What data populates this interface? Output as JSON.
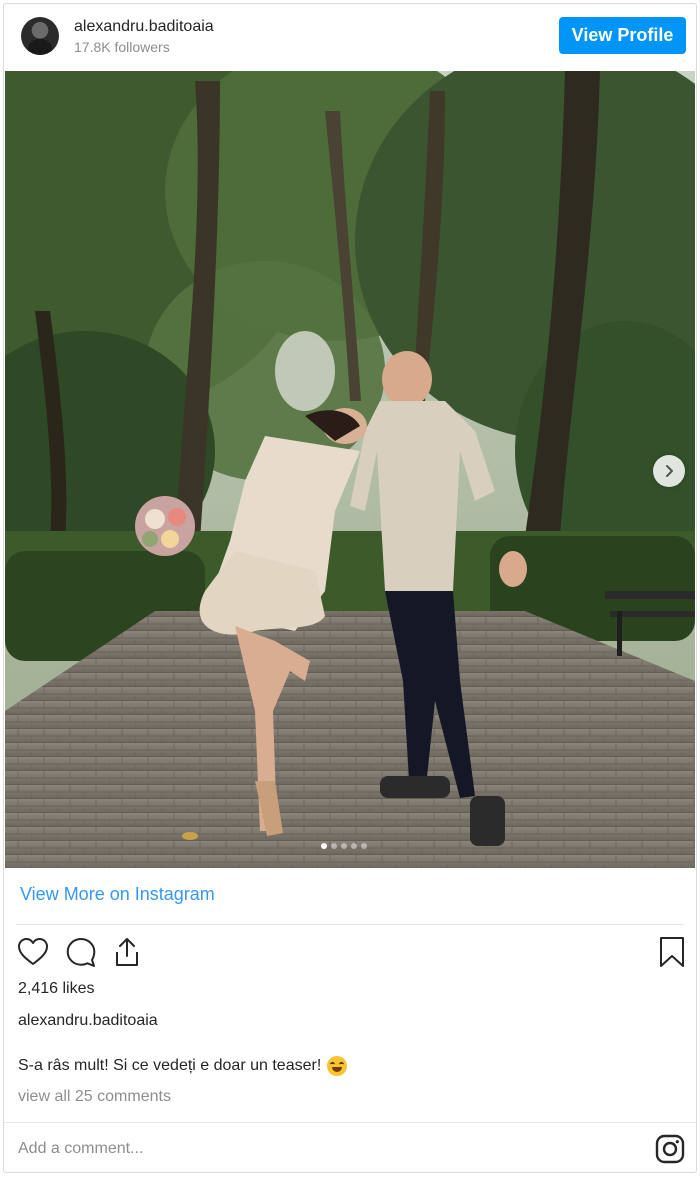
{
  "header": {
    "username": "alexandru.baditoaia",
    "followers": "17.8K followers",
    "view_profile_label": "View Profile"
  },
  "post": {
    "carousel": {
      "total_slides": 5,
      "active_slide": 1
    },
    "view_more_label": "View More on Instagram",
    "likes": "2,416 likes",
    "caption_username": "alexandru.baditoaia",
    "caption_text": "S-a râs mult! Si ce vedeți e doar un teaser!",
    "view_comments_label": "view all 25 comments",
    "add_comment_placeholder": "Add a comment..."
  },
  "icons": {
    "like": "heart-icon",
    "comment": "comment-icon",
    "share": "share-icon",
    "save": "bookmark-icon",
    "next": "chevron-right-icon",
    "instagram": "instagram-logo-icon",
    "emoji": "grinning-sweat-emoji"
  },
  "colors": {
    "accent": "#0095f6",
    "link": "#3897f0",
    "muted": "#8e8e8e",
    "text": "#262626"
  }
}
